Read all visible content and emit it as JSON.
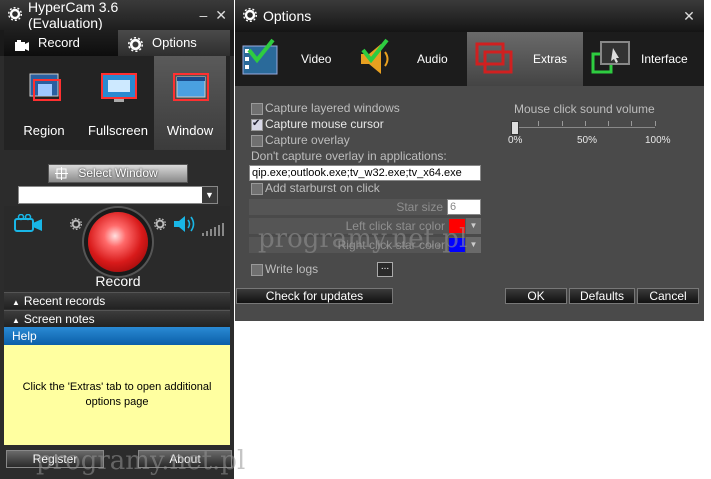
{
  "left_window": {
    "title": "HyperCam 3.6 (Evaluation)",
    "tabs": {
      "record": "Record",
      "options": "Options"
    },
    "modes": [
      "Region",
      "Fullscreen",
      "Window"
    ],
    "select_window_label": "Select Window",
    "window_combo_value": "",
    "record_label": "Record",
    "sections": {
      "recent_records": "Recent records",
      "screen_notes": "Screen notes",
      "help": "Help"
    },
    "help_text": "Click the 'Extras' tab to open additional options page",
    "buttons": {
      "register": "Register",
      "about": "About"
    }
  },
  "options_window": {
    "title": "Options",
    "tabs": [
      "Video",
      "Audio",
      "Extras",
      "Interface"
    ],
    "selected_tab": "Extras",
    "options": {
      "capture_layered_windows": {
        "label": "Capture layered windows",
        "checked": false
      },
      "capture_mouse_cursor": {
        "label": "Capture mouse cursor",
        "checked": true
      },
      "capture_overlay": {
        "label": "Capture overlay",
        "checked": false
      },
      "dont_capture_label": "Don't capture overlay in applications:",
      "overlay_apps_value": "qip.exe;outlook.exe;tv_w32.exe;tv_x64.exe",
      "add_starburst": {
        "label": "Add starburst on click",
        "checked": false
      },
      "star_size_label": "Star size",
      "star_size_value": "6",
      "left_click_label": "Left click star color",
      "left_click_color": "#ff0000",
      "right_click_label": "Right click star color",
      "right_click_color": "#0000ff",
      "write_logs": {
        "label": "Write logs",
        "checked": false
      },
      "browse_label": "..."
    },
    "mouse_click_volume": {
      "label": "Mouse click sound volume",
      "ticks": [
        "0%",
        "50%",
        "100%"
      ],
      "value_percent": 0
    },
    "buttons": {
      "check_updates": "Check for updates",
      "ok": "OK",
      "defaults": "Defaults",
      "cancel": "Cancel"
    }
  },
  "watermarks": [
    "programy.net.pl",
    "programy.net.pl"
  ]
}
